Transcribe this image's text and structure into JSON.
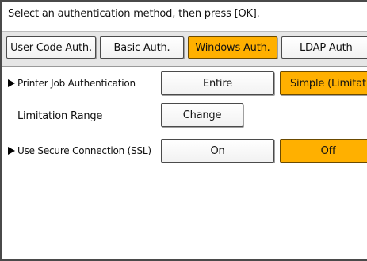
{
  "instruction": "Select an authentication method, then press [OK].",
  "tabs": [
    {
      "label": "User Code Auth.",
      "selected": false
    },
    {
      "label": "Basic Auth.",
      "selected": false
    },
    {
      "label": "Windows Auth.",
      "selected": true
    },
    {
      "label": "LDAP Auth",
      "selected": false
    }
  ],
  "printer_job_auth": {
    "label": "Printer Job Authentication",
    "options": [
      {
        "label": "Entire",
        "selected": false
      },
      {
        "label": "Simple (Limitat",
        "selected": true
      }
    ]
  },
  "limitation_range": {
    "label": "Limitation Range",
    "button": "Change"
  },
  "secure_connection": {
    "label": "Use Secure Connection (SSL)",
    "options": [
      {
        "label": "On",
        "selected": false
      },
      {
        "label": "Off",
        "selected": true
      }
    ]
  },
  "colors": {
    "selected": "#ffb000",
    "band": "#e6e6e6",
    "border": "#4b4b4b"
  }
}
